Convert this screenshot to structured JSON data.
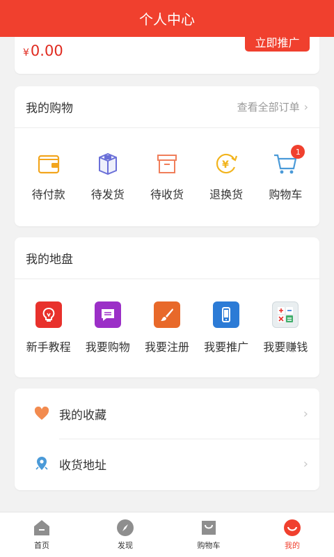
{
  "header": {
    "title": "个人中心"
  },
  "account": {
    "currency": "¥",
    "amount": "0.00",
    "promo_button": "立即推广"
  },
  "shopping": {
    "title": "我的购物",
    "all_orders": "查看全部订单",
    "items": [
      {
        "label": "待付款",
        "icon": "wallet-icon"
      },
      {
        "label": "待发货",
        "icon": "package-icon"
      },
      {
        "label": "待收货",
        "icon": "box-icon"
      },
      {
        "label": "退换货",
        "icon": "exchange-icon"
      },
      {
        "label": "购物车",
        "icon": "cart-icon",
        "badge": "1"
      }
    ]
  },
  "turf": {
    "title": "我的地盘",
    "items": [
      {
        "label": "新手教程",
        "icon": "lightbulb-icon",
        "color": "#e8312c"
      },
      {
        "label": "我要购物",
        "icon": "chat-icon",
        "color": "#9b2fc7"
      },
      {
        "label": "我要注册",
        "icon": "brush-icon",
        "color": "#e8692a"
      },
      {
        "label": "我要推广",
        "icon": "phone-icon",
        "color": "#2c7bd6"
      },
      {
        "label": "我要赚钱",
        "icon": "calculator-icon",
        "color": "#e9eef0"
      }
    ]
  },
  "list": {
    "items": [
      {
        "label": "我的收藏",
        "icon": "heart-icon"
      },
      {
        "label": "收货地址",
        "icon": "location-pin-icon"
      }
    ]
  },
  "tabbar": {
    "items": [
      {
        "label": "首页",
        "icon": "home-icon"
      },
      {
        "label": "发现",
        "icon": "compass-icon"
      },
      {
        "label": "购物车",
        "icon": "bag-icon"
      },
      {
        "label": "我的",
        "icon": "smile-icon",
        "active": true
      }
    ]
  },
  "colors": {
    "primary": "#f0402e",
    "price": "#e02b20"
  }
}
